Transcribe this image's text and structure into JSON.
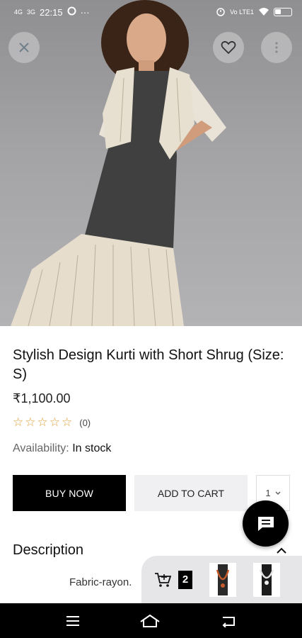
{
  "status_bar": {
    "signal_left": "4G",
    "signal_right": "3G",
    "time": "22:15",
    "more": "···",
    "network_right": "Vo LTE1"
  },
  "product": {
    "title": "Stylish Design Kurti with Short Shrug (Size: S)",
    "price": "₹1,100.00",
    "rating_count": "(0)",
    "stars_filled": 0,
    "stars_total": 5,
    "availability_label": "Availability:",
    "availability_value": "In stock"
  },
  "actions": {
    "buy_now": "BUY NOW",
    "add_to_cart": "ADD TO CART",
    "quantity": "1"
  },
  "description": {
    "heading": "Description",
    "text": "Fabric-rayon."
  },
  "mini_cart": {
    "count": "2"
  },
  "colors": {
    "accent": "#000000",
    "star": "#e0a03a",
    "hero_bg": "#a3a3a5"
  },
  "icons": {
    "close": "close-icon",
    "wishlist": "heart-icon",
    "more": "more-vertical-icon",
    "chat": "chat-icon",
    "cart": "cart-add-icon",
    "nav_menu": "menu-icon",
    "nav_home": "home-icon",
    "nav_back": "back-icon"
  }
}
